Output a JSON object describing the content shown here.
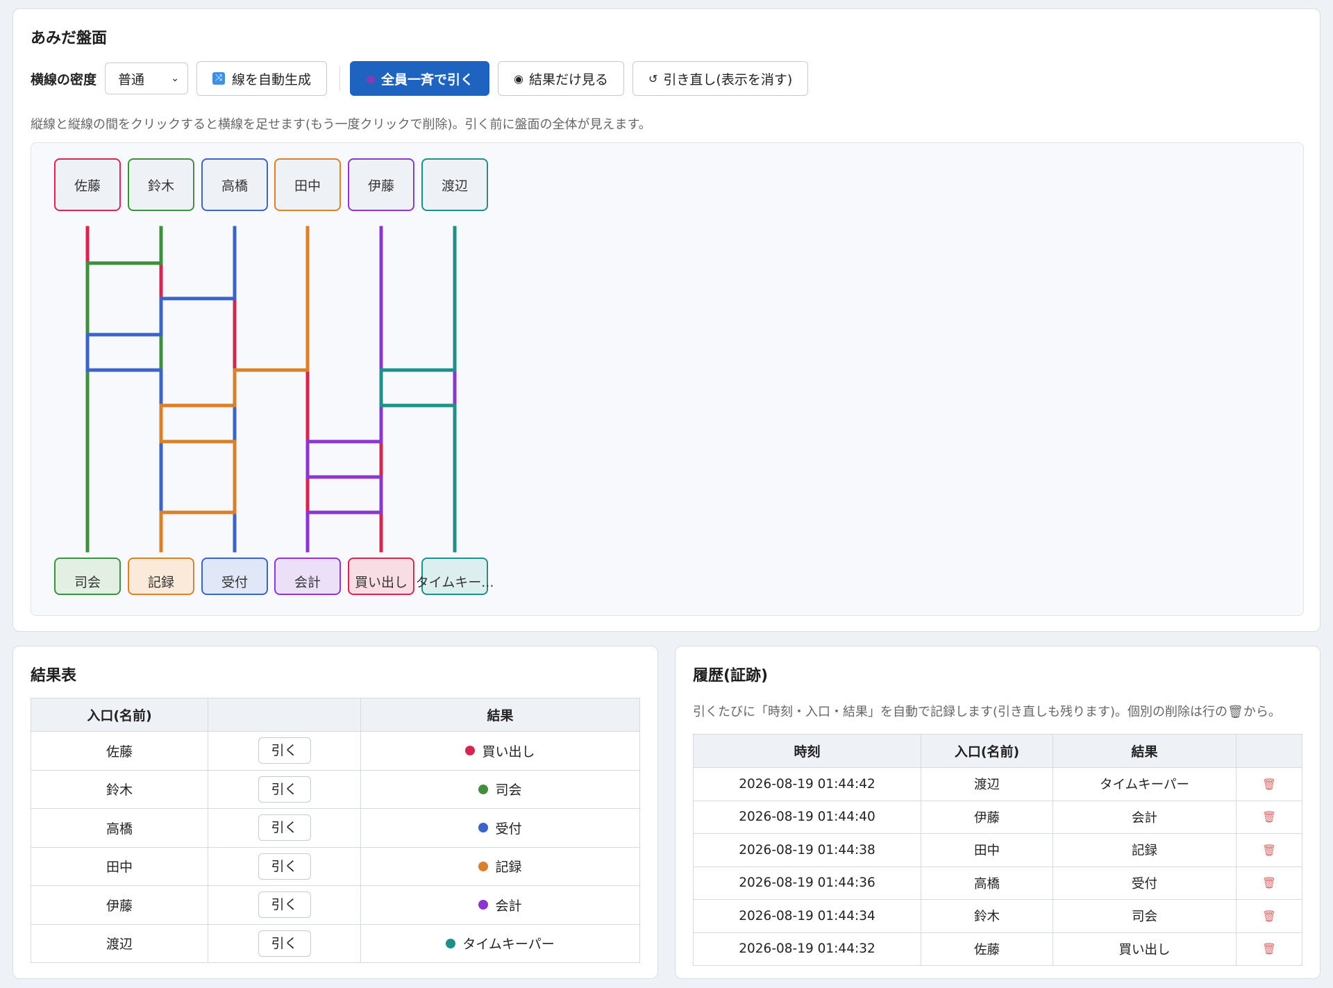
{
  "board": {
    "title": "あみだ盤面",
    "density_label": "横線の密度",
    "density_value": "普通",
    "auto_generate_label": "線を自動生成",
    "draw_all_label": "全員一斉で引く",
    "show_results_label": "結果だけ見る",
    "reset_label": "引き直し(表示を消す)",
    "hint": "縦線と縦線の間をクリックすると横線を足せます(もう一度クリックで削除)。引く前に盤面の全体が見えます。",
    "participants": [
      {
        "name": "佐藤",
        "color": "#d6264f"
      },
      {
        "name": "鈴木",
        "color": "#3f8f3f"
      },
      {
        "name": "高橋",
        "color": "#3b63c9"
      },
      {
        "name": "田中",
        "color": "#d9812a"
      },
      {
        "name": "伊藤",
        "color": "#8a36cf"
      },
      {
        "name": "渡辺",
        "color": "#1f8f8a"
      }
    ],
    "results": [
      {
        "label": "司会",
        "color": "#3f8f3f",
        "bg": "#e3efe3"
      },
      {
        "label": "記録",
        "color": "#d9812a",
        "bg": "#fbe9d9"
      },
      {
        "label": "受付",
        "color": "#3b63c9",
        "bg": "#e0e7f7"
      },
      {
        "label": "会計",
        "color": "#8a36cf",
        "bg": "#ecdff8"
      },
      {
        "label": "買い出し",
        "color": "#d6264f",
        "bg": "#f8dde4"
      },
      {
        "label": "タイムキー...",
        "color": "#1f8f8a",
        "bg": "#dceeed"
      }
    ],
    "rungs": [
      {
        "col": 0,
        "y": 1
      },
      {
        "col": 1,
        "y": 2
      },
      {
        "col": 0,
        "y": 3
      },
      {
        "col": 0,
        "y": 4
      },
      {
        "col": 2,
        "y": 4
      },
      {
        "col": 4,
        "y": 4
      },
      {
        "col": 1,
        "y": 5
      },
      {
        "col": 4,
        "y": 5
      },
      {
        "col": 1,
        "y": 6
      },
      {
        "col": 3,
        "y": 6
      },
      {
        "col": 3,
        "y": 7
      },
      {
        "col": 1,
        "y": 8
      },
      {
        "col": 3,
        "y": 8
      }
    ]
  },
  "result_table": {
    "title": "結果表",
    "headers": [
      "入口(名前)",
      "",
      "結果"
    ],
    "draw_button_label": "引く",
    "rows": [
      {
        "name": "佐藤",
        "result": "買い出し",
        "color": "#d6264f"
      },
      {
        "name": "鈴木",
        "result": "司会",
        "color": "#3f8f3f"
      },
      {
        "name": "高橋",
        "result": "受付",
        "color": "#3b63c9"
      },
      {
        "name": "田中",
        "result": "記録",
        "color": "#d9812a"
      },
      {
        "name": "伊藤",
        "result": "会計",
        "color": "#8a36cf"
      },
      {
        "name": "渡辺",
        "result": "タイムキーパー",
        "color": "#1f8f8a"
      }
    ]
  },
  "history": {
    "title": "履歴(証跡)",
    "hint": "引くたびに「時刻・入口・結果」を自動で記録します(引き直しも残ります)。個別の削除は行の🗑から。",
    "headers": [
      "時刻",
      "入口(名前)",
      "結果",
      ""
    ],
    "delete_icon": "trash-icon",
    "rows": [
      {
        "time": "2026-08-19 01:44:42",
        "name": "渡辺",
        "result": "タイムキーパー"
      },
      {
        "time": "2026-08-19 01:44:40",
        "name": "伊藤",
        "result": "会計"
      },
      {
        "time": "2026-08-19 01:44:38",
        "name": "田中",
        "result": "記録"
      },
      {
        "time": "2026-08-19 01:44:36",
        "name": "高橋",
        "result": "受付"
      },
      {
        "time": "2026-08-19 01:44:34",
        "name": "鈴木",
        "result": "司会"
      },
      {
        "time": "2026-08-19 01:44:32",
        "name": "佐藤",
        "result": "買い出し"
      }
    ]
  }
}
